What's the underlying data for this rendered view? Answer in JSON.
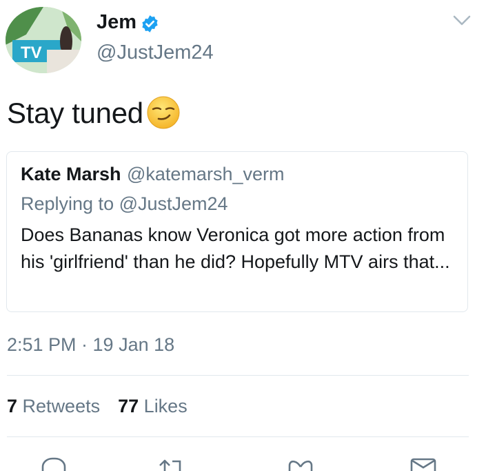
{
  "author": {
    "name": "Jem",
    "handle": "@JustJem24",
    "avatar_text": "TV"
  },
  "tweet": {
    "text": "Stay tuned",
    "emoji": "smirking-face-emoji"
  },
  "quoted": {
    "name": "Kate Marsh",
    "handle": "@katemarsh_verm",
    "replying_prefix": "Replying to ",
    "replying_to": "@JustJem24",
    "text": "Does Bananas know Veronica got more action from his 'girlfriend' than he did? Hopefully MTV airs that..."
  },
  "timestamp": "2:51 PM · 19 Jan 18",
  "stats": {
    "retweets_count": "7",
    "retweets_label": "Retweets",
    "likes_count": "77",
    "likes_label": "Likes"
  },
  "actions": [
    "reply-icon",
    "retweet-icon",
    "like-icon",
    "share-icon"
  ],
  "colors": {
    "verified": "#1da1f2",
    "secondary_text": "#657786",
    "primary_text": "#14171a",
    "divider": "#e1e8ed"
  }
}
